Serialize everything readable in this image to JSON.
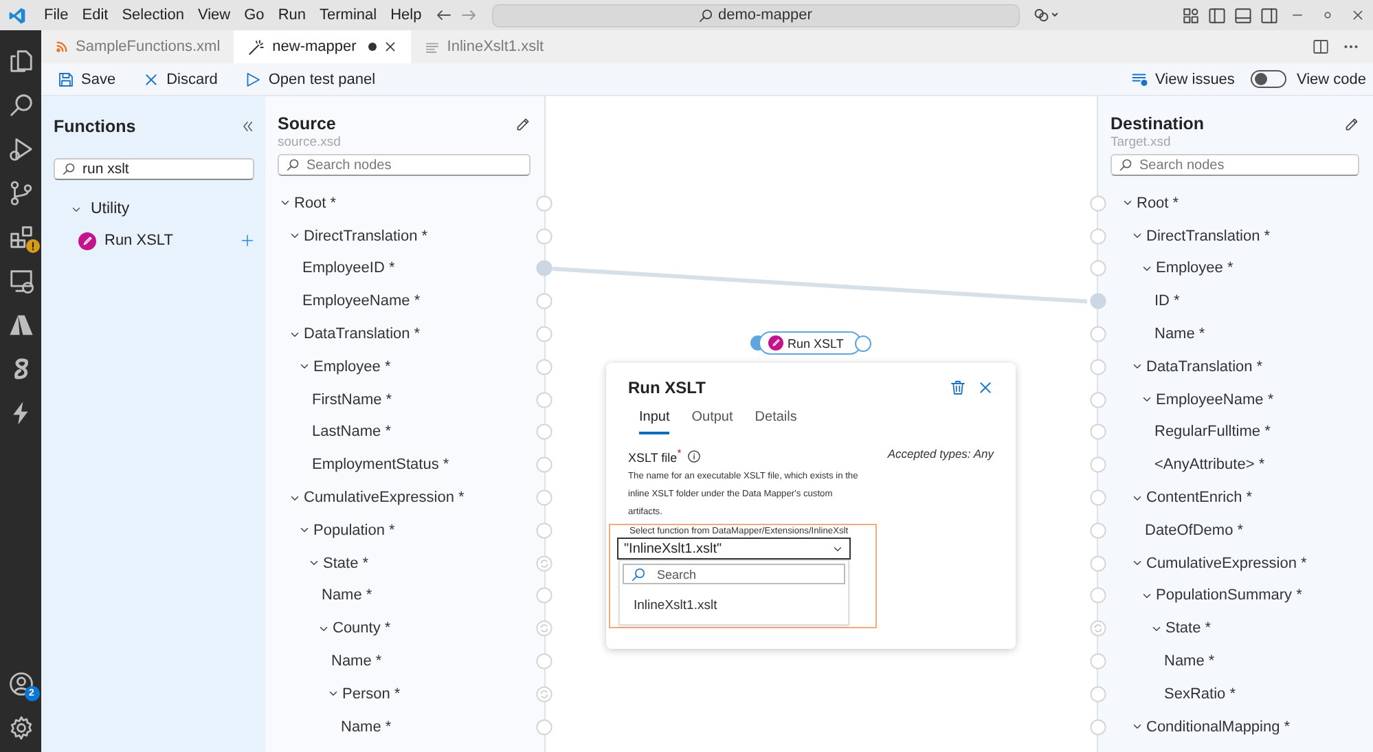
{
  "title_bar": {
    "menu": [
      "File",
      "Edit",
      "Selection",
      "View",
      "Go",
      "Run",
      "Terminal",
      "Help"
    ],
    "search": "demo-mapper"
  },
  "activity_bar": {
    "extensions_warning": true,
    "account_badge": "2"
  },
  "tabs": [
    {
      "label": "SampleFunctions.xml",
      "kind": "xml",
      "selected": false,
      "modified": false
    },
    {
      "label": "new-mapper",
      "kind": "mapper",
      "selected": true,
      "modified": true
    },
    {
      "label": "InlineXslt1.xslt",
      "kind": "xslt",
      "selected": false,
      "modified": false
    }
  ],
  "toolbar": {
    "actions": [
      {
        "label": "Save",
        "kind": "save"
      },
      {
        "label": "Discard",
        "kind": "discard"
      },
      {
        "label": "Open test panel",
        "kind": "test"
      }
    ],
    "view_issues": "View issues",
    "view_code": {
      "label": "View code",
      "on": false
    }
  },
  "functions": {
    "title": "Functions",
    "search": {
      "value": "run xslt"
    },
    "groups": [
      {
        "label": "Utility",
        "expanded": true,
        "items": [
          "Run XSLT"
        ]
      }
    ]
  },
  "source": {
    "title": "Source",
    "file": "source.xsd",
    "search": {
      "placeholder": "Search nodes"
    },
    "nodes": [
      {
        "label": "Root *",
        "expanded": true,
        "connected": false,
        "repeating": false,
        "children": [
          {
            "label": "DirectTranslation *",
            "expanded": true,
            "connected": false,
            "repeating": false,
            "children": [
              {
                "label": "EmployeeID *",
                "connected": true,
                "repeating": false
              },
              {
                "label": "EmployeeName *",
                "connected": false,
                "repeating": false
              }
            ]
          },
          {
            "label": "DataTranslation *",
            "expanded": true,
            "connected": false,
            "repeating": false,
            "children": [
              {
                "label": "Employee *",
                "expanded": true,
                "connected": false,
                "repeating": false,
                "children": [
                  {
                    "label": "FirstName *",
                    "connected": false,
                    "repeating": false
                  },
                  {
                    "label": "LastName *",
                    "connected": false,
                    "repeating": false
                  },
                  {
                    "label": "EmploymentStatus *",
                    "connected": false,
                    "repeating": false
                  }
                ]
              }
            ]
          },
          {
            "label": "CumulativeExpression *",
            "expanded": true,
            "connected": false,
            "repeating": false,
            "children": [
              {
                "label": "Population *",
                "expanded": true,
                "connected": false,
                "repeating": false,
                "children": [
                  {
                    "label": "State *",
                    "expanded": true,
                    "connected": false,
                    "repeating": true,
                    "children": [
                      {
                        "label": "Name *",
                        "connected": false,
                        "repeating": false
                      },
                      {
                        "label": "County *",
                        "expanded": true,
                        "connected": false,
                        "repeating": true,
                        "children": [
                          {
                            "label": "Name *",
                            "connected": false,
                            "repeating": false
                          },
                          {
                            "label": "Person *",
                            "expanded": true,
                            "connected": false,
                            "repeating": true,
                            "children": [
                              {
                                "label": "Name *",
                                "connected": false,
                                "repeating": false
                              }
                            ]
                          }
                        ]
                      }
                    ]
                  }
                ]
              }
            ]
          }
        ]
      }
    ]
  },
  "canvas": {
    "function_node": {
      "label": "Run XSLT"
    },
    "panel": {
      "title": "Run XSLT",
      "tabs": [
        {
          "label": "Input",
          "selected": true
        },
        {
          "label": "Output",
          "selected": false
        },
        {
          "label": "Details",
          "selected": false
        }
      ],
      "field_label": "XSLT file$^{*}$",
      "accepted": "Accepted types: Any",
      "description": "The name for an executable XSLT file, which exists in the inline XSLT folder under the Data Mapper's custom artifacts.",
      "highlighted": true,
      "select_caption": "Select function from DataMapper/Extensions/InlineXslt",
      "value": "\"InlineXslt1.xslt\"",
      "dropdown_search": {
        "placeholder": "Search"
      },
      "options": [
        {
          "label": "InlineXslt1.xslt",
          "selected": false
        }
      ]
    }
  },
  "destination": {
    "title": "Destination",
    "file": "Target.xsd",
    "search": {
      "placeholder": "Search nodes"
    },
    "nodes": [
      {
        "label": "Root *",
        "expanded": true,
        "connected": false,
        "repeating": false,
        "children": [
          {
            "label": "DirectTranslation *",
            "expanded": true,
            "connected": false,
            "repeating": false,
            "children": [
              {
                "label": "Employee *",
                "expanded": true,
                "connected": false,
                "repeating": false,
                "children": [
                  {
                    "label": "ID *",
                    "connected": true,
                    "repeating": false
                  },
                  {
                    "label": "Name *",
                    "connected": false,
                    "repeating": false
                  }
                ]
              }
            ]
          },
          {
            "label": "DataTranslation *",
            "expanded": true,
            "connected": false,
            "repeating": false,
            "children": [
              {
                "label": "EmployeeName *",
                "expanded": true,
                "connected": false,
                "repeating": false,
                "children": [
                  {
                    "label": "RegularFulltime *",
                    "connected": false,
                    "repeating": false
                  },
                  {
                    "label": "<AnyAttribute> *",
                    "connected": false,
                    "repeating": false
                  }
                ]
              }
            ]
          },
          {
            "label": "ContentEnrich *",
            "expanded": true,
            "connected": false,
            "repeating": false,
            "children": [
              {
                "label": "DateOfDemo *",
                "connected": false,
                "repeating": false
              }
            ]
          },
          {
            "label": "CumulativeExpression *",
            "expanded": true,
            "connected": false,
            "repeating": false,
            "children": [
              {
                "label": "PopulationSummary *",
                "expanded": true,
                "connected": false,
                "repeating": false,
                "children": [
                  {
                    "label": "State *",
                    "expanded": true,
                    "connected": false,
                    "repeating": true,
                    "children": [
                      {
                        "label": "Name *",
                        "connected": false,
                        "repeating": false
                      },
                      {
                        "label": "SexRatio *",
                        "connected": false,
                        "repeating": false
                      }
                    ]
                  }
                ]
              }
            ]
          },
          {
            "label": "ConditionalMapping *",
            "expanded": true,
            "connected": false,
            "repeating": false
          }
        ]
      }
    ]
  }
}
